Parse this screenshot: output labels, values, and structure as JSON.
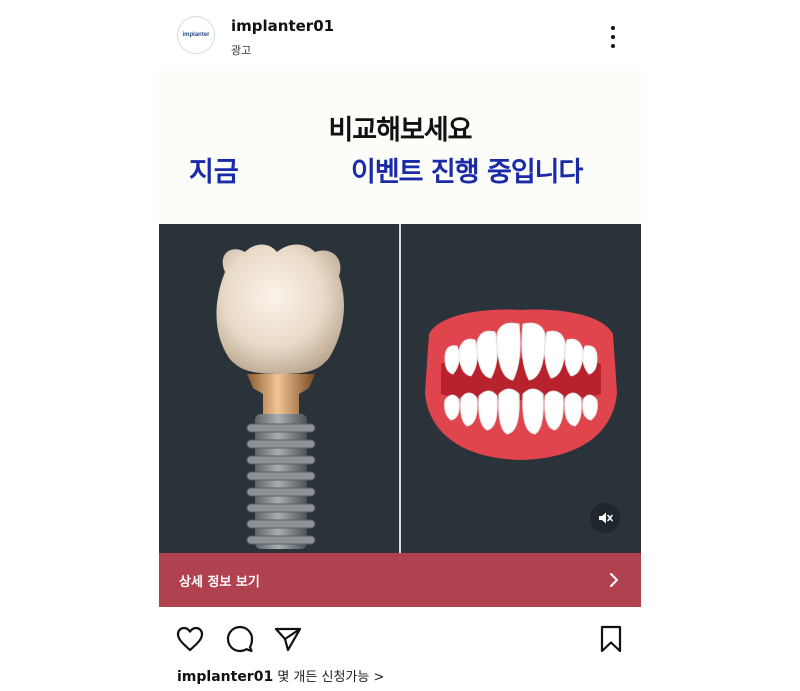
{
  "header": {
    "avatar_text": "implanter",
    "username": "implanter01",
    "sublabel": "광고",
    "more_icon": "more-vertical-icon"
  },
  "media": {
    "headline": "비교해보세요",
    "subline_left": "지금",
    "subline_right": "이벤트 진행 중입니다",
    "left_image": "dental-implant-image",
    "right_image": "teeth-illustration-image",
    "mute_icon": "volume-muted-icon",
    "cta_label": "상세 정보 보기",
    "cta_icon": "chevron-right-icon"
  },
  "actions": {
    "like_icon": "heart-icon",
    "comment_icon": "comment-icon",
    "share_icon": "send-icon",
    "save_icon": "bookmark-icon"
  },
  "caption": {
    "username": "implanter01",
    "text": "몇 개든 신청가능 >"
  },
  "colors": {
    "banner_text_blue": "#1a2aa8",
    "cta_background": "#b0414e",
    "panel_background": "#2a333a"
  }
}
